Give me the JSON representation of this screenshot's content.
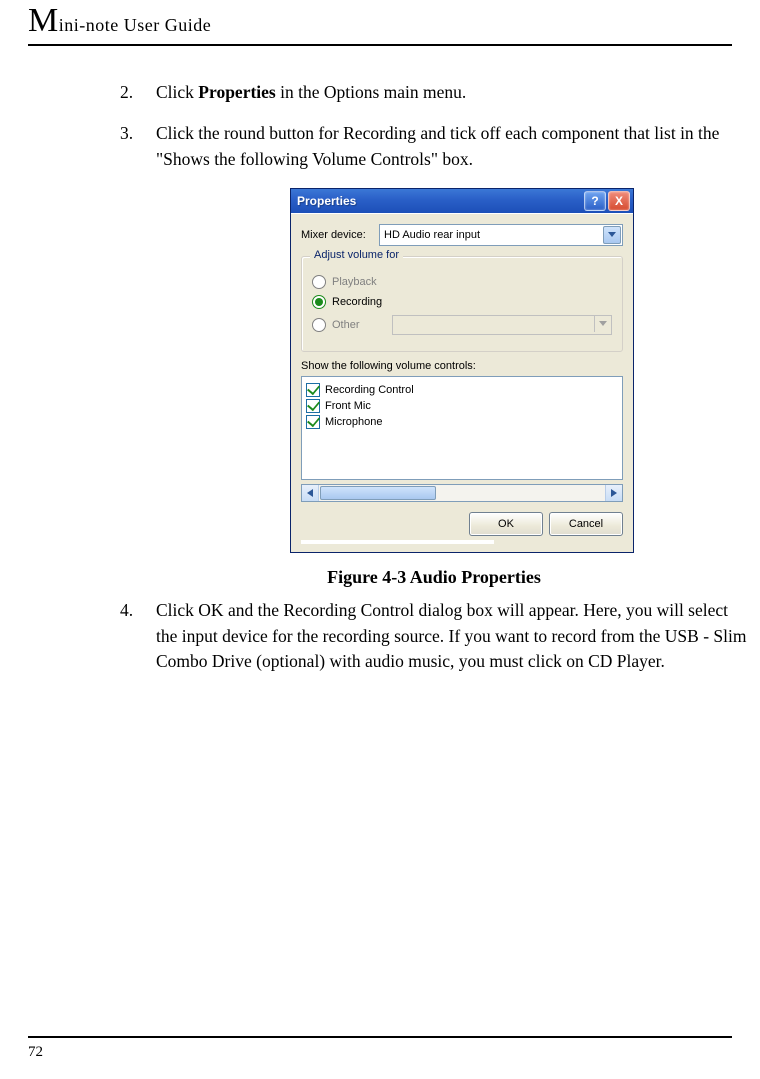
{
  "header": {
    "title_prefix_big": "M",
    "title_rest": "ini-note User Guide"
  },
  "steps": {
    "s2_num": "2.",
    "s2_a": "Click ",
    "s2_bold": "Properties",
    "s2_b": " in the Options main menu.",
    "s3_num": "3.",
    "s3": "Click the round button for Recording and tick off each component that list in the \"Shows the following Volume Controls\" box.",
    "s4_num": "4.",
    "s4": "Click OK and the Recording Control dialog box will appear. Here, you will select the input device for the recording source. If you want to record from the USB - Slim Combo Drive (optional) with audio music, you must click on CD Player."
  },
  "dialog": {
    "title": "Properties",
    "help_glyph": "?",
    "close_glyph": "X",
    "mixer_label": "Mixer device:",
    "mixer_value": "HD Audio rear input",
    "group_legend": "Adjust volume for",
    "radio_playback": "Playback",
    "radio_recording": "Recording",
    "radio_other": "Other",
    "list_label": "Show the following volume controls:",
    "items": {
      "a": "Recording Control",
      "b": "Front Mic",
      "c": "Microphone"
    },
    "ok": "OK",
    "cancel": "Cancel"
  },
  "caption": "Figure 4-3   Audio Properties",
  "page_number": "72"
}
